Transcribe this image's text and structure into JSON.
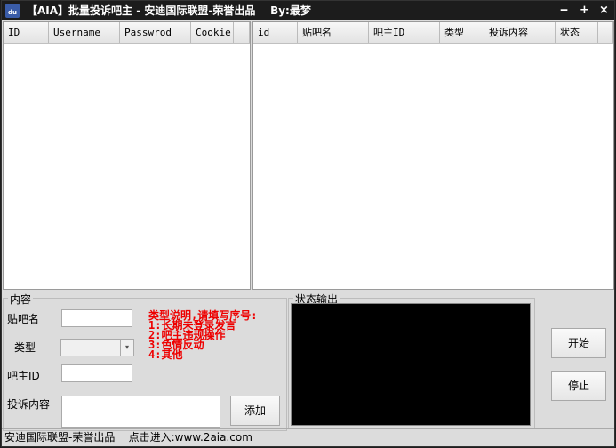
{
  "titlebar": {
    "title": "【AIA】批量投诉吧主 - 安迪国际联盟-荣誉出品",
    "author": "By:最梦",
    "minimize": "‒",
    "maximize": "+",
    "close": "×"
  },
  "accounts_list": {
    "columns": [
      "ID",
      "Username",
      "Passwrod",
      "Cookie"
    ]
  },
  "tasks_list": {
    "columns": [
      "id",
      "贴吧名",
      "吧主ID",
      "类型",
      "投诉内容",
      "状态"
    ]
  },
  "content_group": {
    "label": "内容",
    "bar_name_label": "贴吧名",
    "bar_name_value": "",
    "type_label": "类型",
    "type_value": "",
    "owner_id_label": "吧主ID",
    "owner_id_value": "",
    "complaint_label": "投诉内容",
    "complaint_value": "",
    "add_button": "添加"
  },
  "type_help": [
    "类型说明,请填写序号:",
    "1:长期未登录发言",
    "2:吧主违规操作",
    "3:色情反动",
    "4:其他"
  ],
  "output_group": {
    "label": "状态输出"
  },
  "buttons": {
    "start": "开始",
    "stop": "停止"
  },
  "statusbar": {
    "credit": "安迪国际联盟-荣誉出品",
    "link": "点击进入:www.2aia.com"
  }
}
